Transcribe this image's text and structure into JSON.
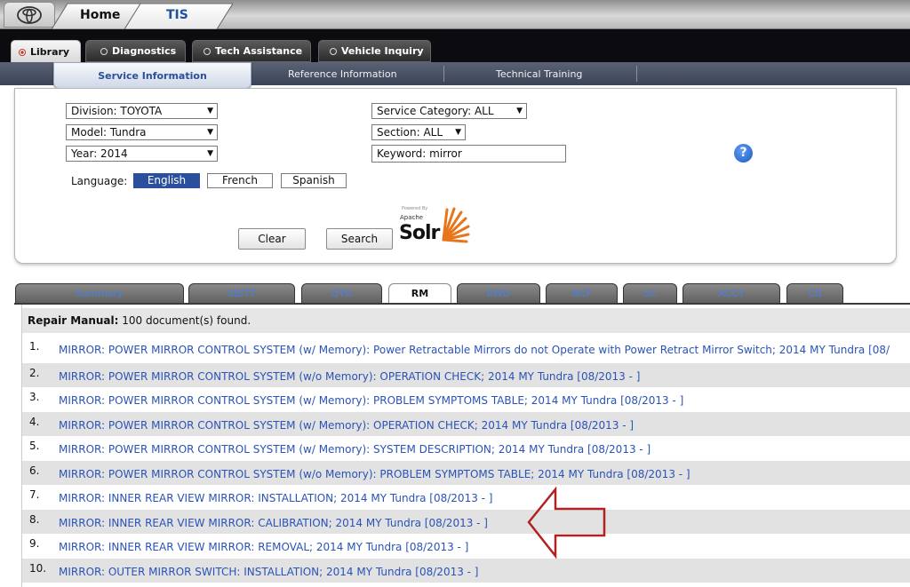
{
  "top_tabs": {
    "home": "Home",
    "tis": "TIS"
  },
  "main_tabs": [
    {
      "label": "Library",
      "active": true
    },
    {
      "label": "Diagnostics",
      "active": false
    },
    {
      "label": "Tech Assistance",
      "active": false
    },
    {
      "label": "Vehicle Inquiry",
      "active": false
    }
  ],
  "sub_tabs": [
    {
      "label": "Service Information",
      "active": true
    },
    {
      "label": "Reference Information",
      "active": false
    },
    {
      "label": "Technical Training",
      "active": false
    }
  ],
  "search": {
    "division": "Division: TOYOTA",
    "model": "Model: Tundra",
    "year": "Year: 2014",
    "service_category": "Service Category: ALL",
    "section": "Section: ALL",
    "keyword": "Keyword: mirror",
    "language_label": "Language:",
    "languages": [
      {
        "label": "English",
        "selected": true
      },
      {
        "label": "French",
        "selected": false
      },
      {
        "label": "Spanish",
        "selected": false
      }
    ],
    "clear_label": "Clear",
    "search_label": "Search",
    "powered_by": "Powered By",
    "apache": "Apache",
    "solr": "Solr"
  },
  "result_tabs": [
    {
      "label": "Summary",
      "active": false
    },
    {
      "label": "SB/TT",
      "active": false
    },
    {
      "label": "QTG",
      "active": false
    },
    {
      "label": "RM",
      "active": true
    },
    {
      "label": "EWD",
      "active": false
    },
    {
      "label": "NCF",
      "active": false
    },
    {
      "label": "SC",
      "active": false
    },
    {
      "label": "ACCY",
      "active": false
    },
    {
      "label": "CR",
      "active": false
    }
  ],
  "results": {
    "header_bold": "Repair Manual:",
    "header_count": " 100 document(s) found.",
    "items": [
      {
        "num": "1.",
        "text": "MIRROR: POWER MIRROR CONTROL SYSTEM (w/ Memory): Power Retractable Mirrors do not Operate with Power Retract Mirror Switch; 2014 MY Tundra [08/"
      },
      {
        "num": "2.",
        "text": "MIRROR: POWER MIRROR CONTROL SYSTEM (w/o Memory): OPERATION CHECK; 2014 MY Tundra [08/2013 - ]"
      },
      {
        "num": "3.",
        "text": "MIRROR: POWER MIRROR CONTROL SYSTEM (w/ Memory): PROBLEM SYMPTOMS TABLE; 2014 MY Tundra [08/2013 - ]"
      },
      {
        "num": "4.",
        "text": "MIRROR: POWER MIRROR CONTROL SYSTEM (w/ Memory): OPERATION CHECK; 2014 MY Tundra [08/2013 - ]"
      },
      {
        "num": "5.",
        "text": "MIRROR: POWER MIRROR CONTROL SYSTEM (w/ Memory): SYSTEM DESCRIPTION; 2014 MY Tundra [08/2013 - ]"
      },
      {
        "num": "6.",
        "text": "MIRROR: POWER MIRROR CONTROL SYSTEM (w/o Memory): PROBLEM SYMPTOMS TABLE; 2014 MY Tundra [08/2013 - ]"
      },
      {
        "num": "7.",
        "text": "MIRROR: INNER REAR VIEW MIRROR: INSTALLATION; 2014 MY Tundra [08/2013 - ]"
      },
      {
        "num": "8.",
        "text": "MIRROR: INNER REAR VIEW MIRROR: CALIBRATION; 2014 MY Tundra [08/2013 - ]"
      },
      {
        "num": "9.",
        "text": "MIRROR: INNER REAR VIEW MIRROR: REMOVAL; 2014 MY Tundra [08/2013 - ]"
      },
      {
        "num": "10.",
        "text": "MIRROR: OUTER MIRROR SWITCH: INSTALLATION; 2014 MY Tundra [08/2013 - ]"
      }
    ]
  },
  "colors": {
    "link": "#2a53b8",
    "active_language": "#2a4f9c",
    "arrow": "#b22222"
  },
  "icons": [
    "toyota-logo-icon",
    "radio-icon",
    "chevron-down-icon",
    "help-icon",
    "solr-sunburst-icon",
    "red-arrow-annotation"
  ]
}
